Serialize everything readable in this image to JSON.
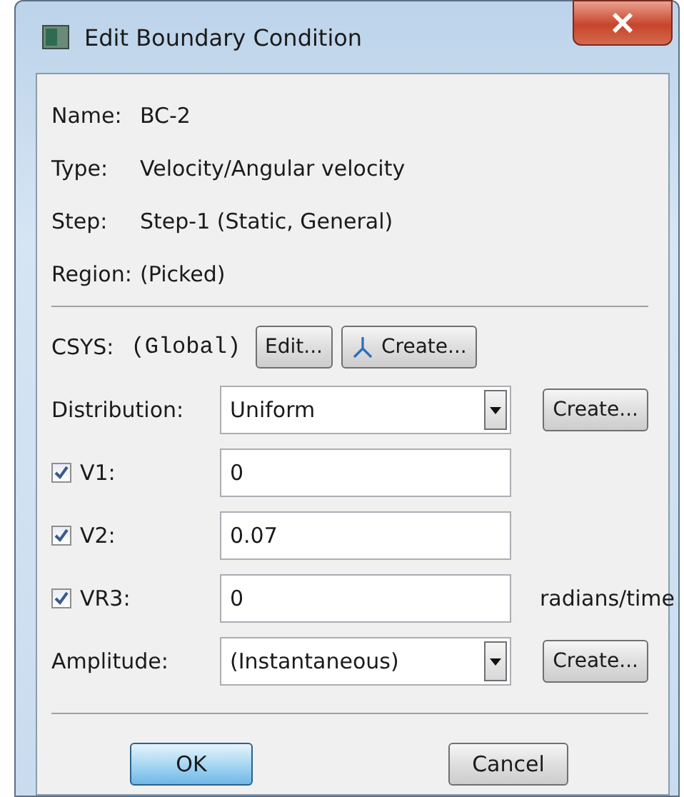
{
  "window": {
    "title": "Edit Boundary Condition"
  },
  "info": [
    {
      "label": "Name:",
      "value": "BC-2"
    },
    {
      "label": "Type:",
      "value": "Velocity/Angular velocity"
    },
    {
      "label": "Step:",
      "value": "Step-1 (Static, General)"
    },
    {
      "label": "Region:",
      "value": "(Picked)"
    }
  ],
  "csys": {
    "label": "CSYS:",
    "value": "(Global)",
    "buttons": [
      {
        "label": "Edit...",
        "kind": "plain"
      },
      {
        "label": "Create...",
        "kind": "axes"
      }
    ]
  },
  "distribution": {
    "label": "Distribution:",
    "value": "Uniform",
    "button": "Create..."
  },
  "components": [
    {
      "label": "V1:",
      "checked": true,
      "value": "0"
    },
    {
      "label": "V2:",
      "checked": true,
      "value": "0.07"
    },
    {
      "label": "VR3:",
      "checked": true,
      "value": "0",
      "unit": "radians/time"
    }
  ],
  "amplitude": {
    "label": "Amplitude:",
    "value": "(Instantaneous)",
    "button": "Create..."
  },
  "buttons": [
    {
      "label": "OK",
      "default": true
    },
    {
      "label": "Cancel",
      "default": false
    }
  ]
}
